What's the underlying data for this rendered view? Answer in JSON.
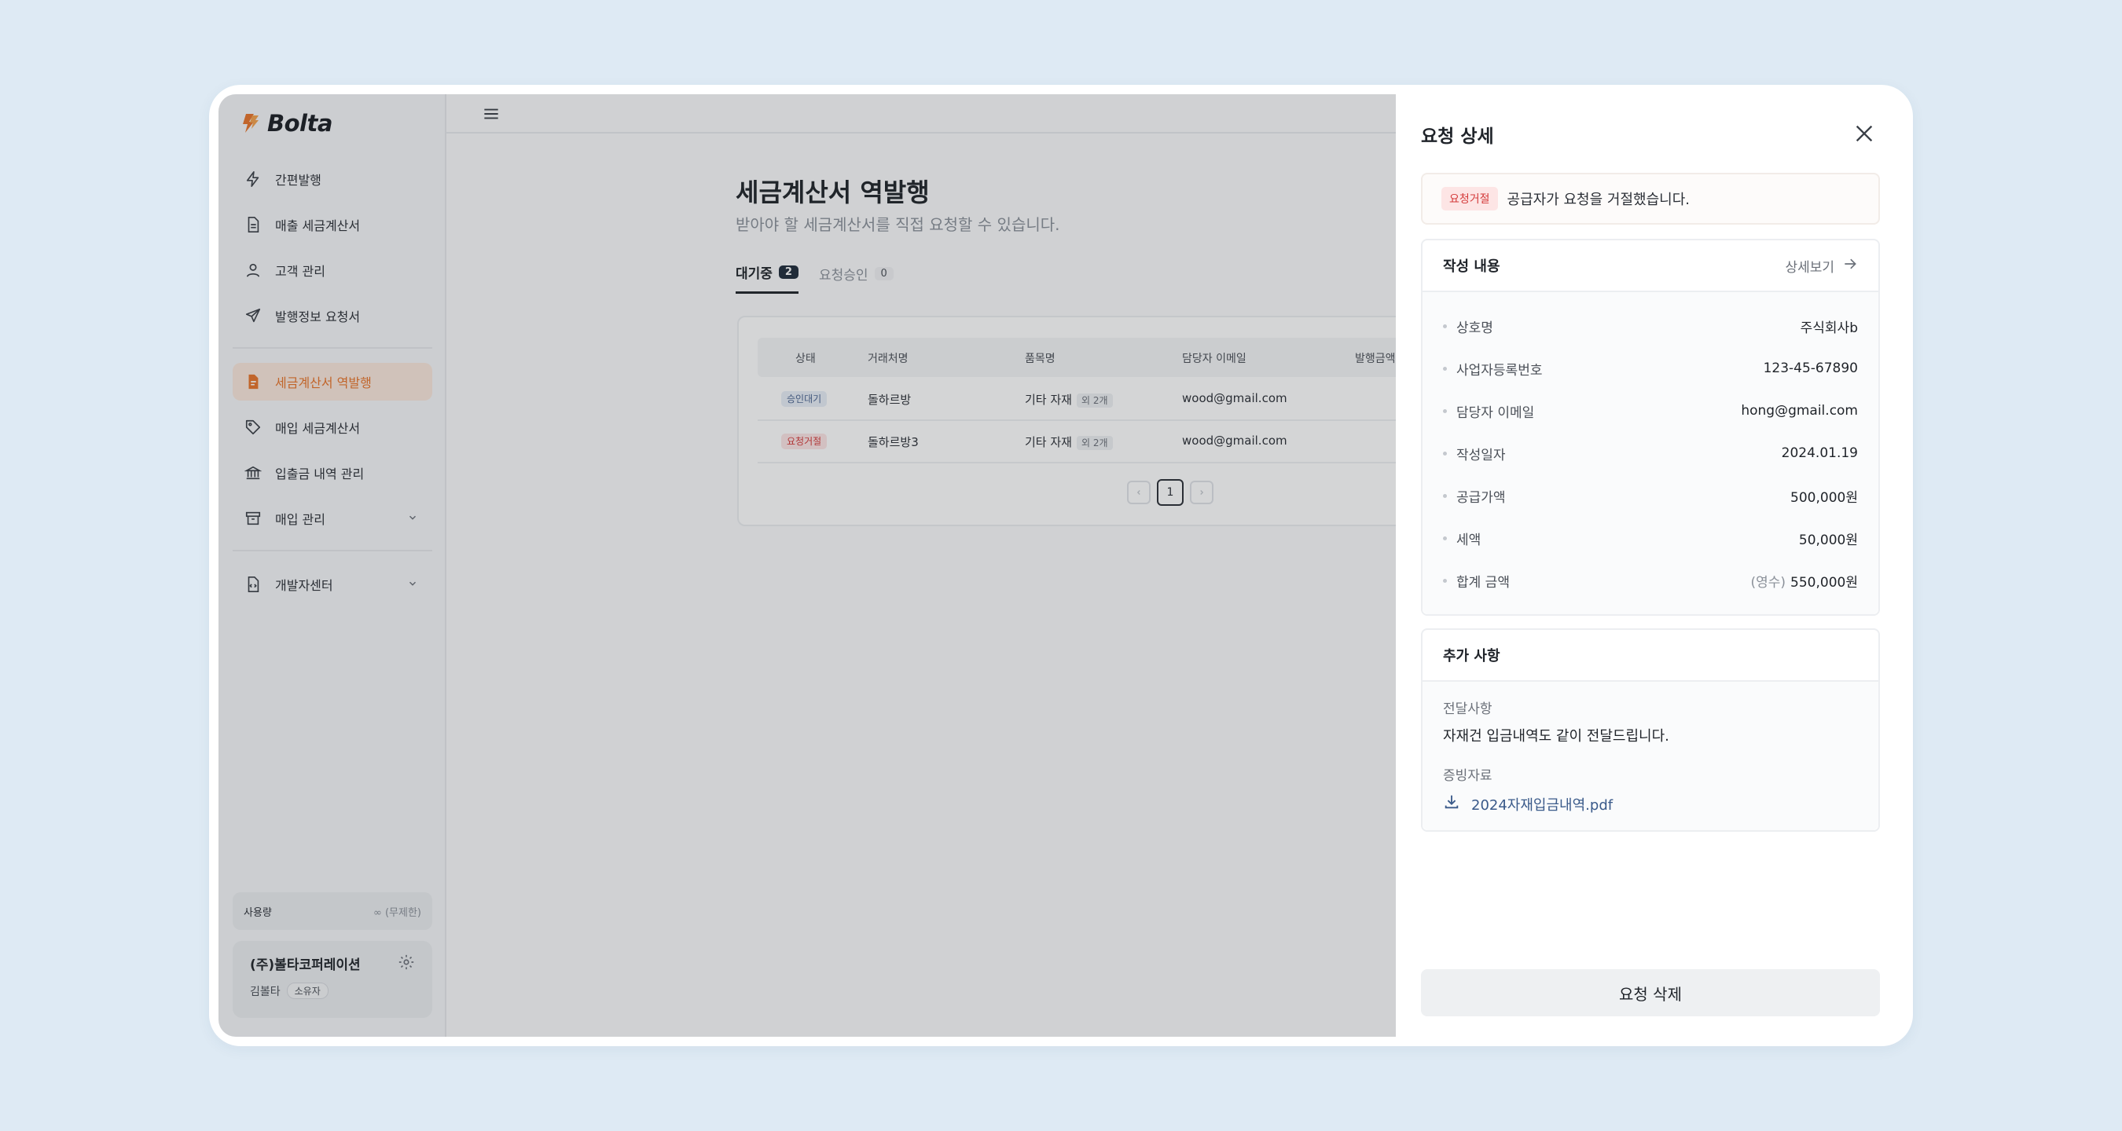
{
  "brand": {
    "name": "Bolta",
    "accent": "#e8732a"
  },
  "sidebar": {
    "items": [
      {
        "label": "간편발행",
        "icon": "lightning-icon"
      },
      {
        "label": "매출 세금계산서",
        "icon": "document-icon"
      },
      {
        "label": "고객 관리",
        "icon": "user-icon"
      },
      {
        "label": "발행정보 요청서",
        "icon": "send-icon"
      }
    ],
    "items2": [
      {
        "label": "세금계산서 역발행",
        "icon": "document-filled-icon",
        "active": true
      },
      {
        "label": "매입 세금계산서",
        "icon": "tag-icon"
      },
      {
        "label": "입출금 내역 관리",
        "icon": "bank-icon"
      },
      {
        "label": "매입 관리",
        "icon": "archive-icon",
        "expandable": true
      }
    ],
    "items3": [
      {
        "label": "개발자센터",
        "icon": "code-file-icon",
        "expandable": true
      }
    ],
    "usage": {
      "label": "사용량",
      "value": "∞ (무제한)"
    },
    "company": {
      "name": "(주)볼타코퍼레이션",
      "user": "김볼타",
      "role": "소유자"
    }
  },
  "main": {
    "title": "세금계산서 역발행",
    "description": "받아야 할 세금계산서를 직접 요청할 수 있습니다.",
    "tabs": [
      {
        "label": "대기중",
        "count": "2",
        "active": true
      },
      {
        "label": "요청승인",
        "count": "0",
        "active": false
      }
    ],
    "table": {
      "headers": [
        "상태",
        "거래처명",
        "품목명",
        "담당자 이메일",
        "발행금액"
      ],
      "rows": [
        {
          "status": "승인대기",
          "status_type": "wait",
          "partner": "돌하르방",
          "item": "기타 자재",
          "more": "외 2개",
          "email": "wood@gmail.com"
        },
        {
          "status": "요청거절",
          "status_type": "rejected",
          "partner": "돌하르방3",
          "item": "기타 자재",
          "more": "외 2개",
          "email": "wood@gmail.com"
        }
      ]
    },
    "pagination": {
      "current": "1"
    }
  },
  "drawer": {
    "title": "요청 상세",
    "alert": {
      "badge": "요청거절",
      "message": "공급자가 요청을 거절했습니다."
    },
    "details": {
      "title": "작성 내용",
      "link": "상세보기",
      "fields": [
        {
          "label": "상호명",
          "value": "주식회사b"
        },
        {
          "label": "사업자등록번호",
          "value": "123-45-67890"
        },
        {
          "label": "담당자 이메일",
          "value": "hong@gmail.com"
        },
        {
          "label": "작성일자",
          "value": "2024.01.19"
        },
        {
          "label": "공급가액",
          "value": "500,000원"
        },
        {
          "label": "세액",
          "value": "50,000원"
        },
        {
          "label": "합계 금액",
          "prefix": "(영수)",
          "value": "550,000원"
        }
      ]
    },
    "extra": {
      "title": "추가 사항",
      "message_label": "전달사항",
      "message": "자재건 입금내역도 같이 전달드립니다.",
      "attachment_label": "증빙자료",
      "attachment": "2024자재입금내역.pdf"
    },
    "delete_button": "요청 삭제"
  }
}
